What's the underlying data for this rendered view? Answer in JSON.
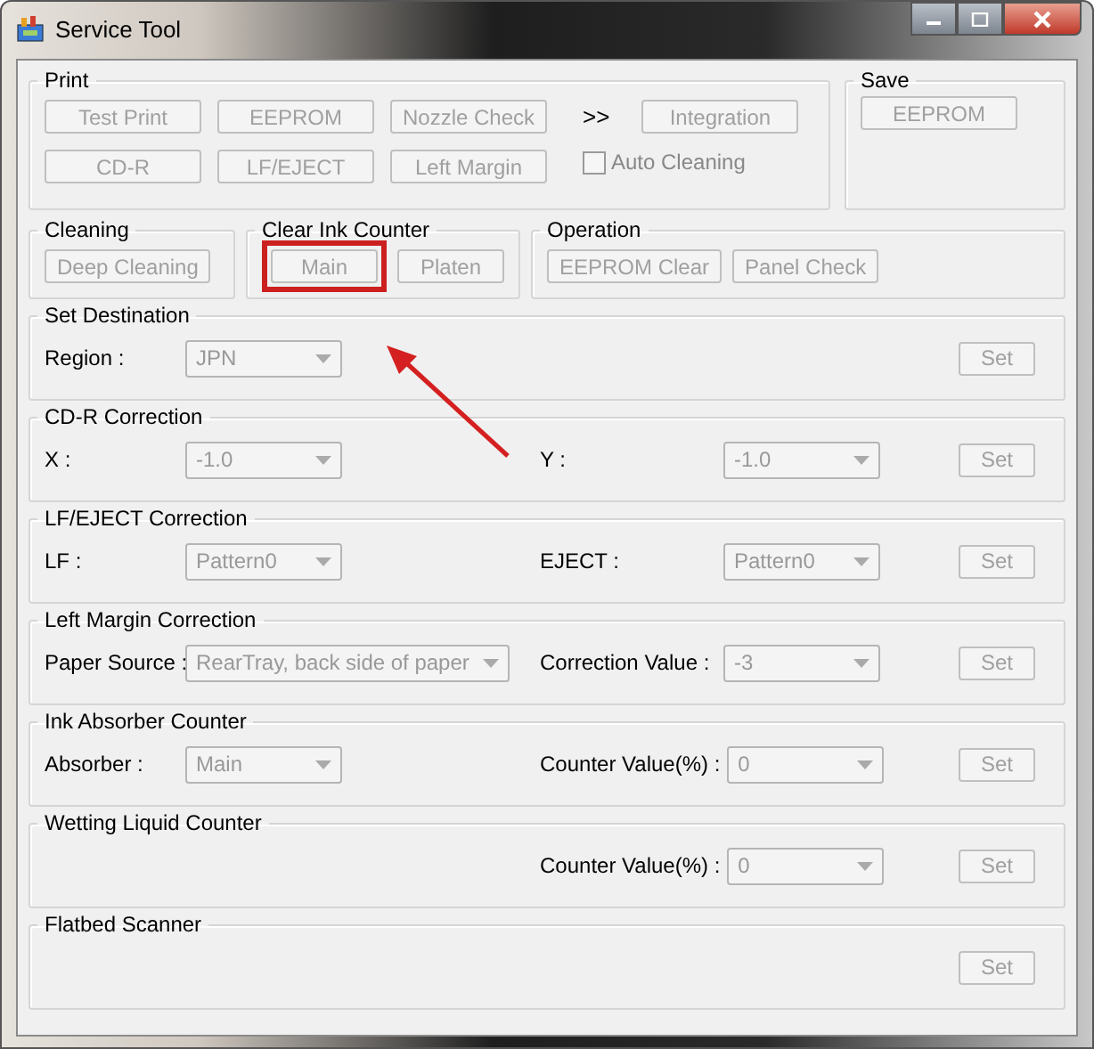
{
  "window": {
    "title": "Service Tool"
  },
  "print": {
    "title": "Print",
    "buttons": [
      {
        "label": "Test Print",
        "disabled": true
      },
      {
        "label": "EEPROM",
        "disabled": true
      },
      {
        "label": "Nozzle Check",
        "disabled": true
      },
      {
        "label": "CD-R",
        "disabled": true
      },
      {
        "label": "LF/EJECT",
        "disabled": true
      },
      {
        "label": "Left Margin",
        "disabled": true
      }
    ],
    "more": ">>",
    "integration": {
      "label": "Integration",
      "disabled": true
    },
    "auto_cleaning": {
      "label": "Auto Cleaning",
      "checked": false
    }
  },
  "save": {
    "title": "Save",
    "buttons": [
      {
        "label": "EEPROM",
        "disabled": true
      }
    ]
  },
  "cleaning": {
    "title": "Cleaning",
    "buttons": [
      {
        "label": "Deep Cleaning",
        "disabled": true
      }
    ]
  },
  "clear_ink_counter": {
    "title": "Clear Ink Counter",
    "buttons": [
      {
        "label": "Main",
        "disabled": true,
        "highlighted": true
      },
      {
        "label": "Platen",
        "disabled": true,
        "highlighted": false
      }
    ]
  },
  "operation": {
    "title": "Operation",
    "buttons": [
      {
        "label": "EEPROM Clear",
        "disabled": true
      },
      {
        "label": "Panel Check",
        "disabled": true
      }
    ]
  },
  "sections": [
    {
      "title": "Set Destination",
      "left": {
        "label": "Region :",
        "value": "JPN"
      },
      "button": {
        "label": "Set",
        "disabled": true
      }
    },
    {
      "title": "CD-R Correction",
      "left": {
        "label": "X :",
        "value": "-1.0"
      },
      "right": {
        "label": "Y :",
        "value": "-1.0"
      },
      "button": {
        "label": "Set",
        "disabled": true
      }
    },
    {
      "title": "LF/EJECT Correction",
      "left": {
        "label": "LF :",
        "value": "Pattern0"
      },
      "right": {
        "label": "EJECT :",
        "value": "Pattern0"
      },
      "button": {
        "label": "Set",
        "disabled": true
      }
    },
    {
      "title": "Left Margin Correction",
      "left": {
        "label": "Paper Source :",
        "value": "RearTray, back side of paper"
      },
      "right": {
        "label": "Correction Value :",
        "value": "-3"
      },
      "button": {
        "label": "Set",
        "disabled": true
      }
    },
    {
      "title": "Ink Absorber Counter",
      "left": {
        "label": "Absorber :",
        "value": "Main"
      },
      "right": {
        "label": "Counter Value(%) :",
        "value": "0"
      },
      "button": {
        "label": "Set",
        "disabled": true
      }
    },
    {
      "title": "Wetting Liquid Counter",
      "right": {
        "label": "Counter Value(%) :",
        "value": "0"
      },
      "button": {
        "label": "Set",
        "disabled": true
      }
    },
    {
      "title": "Flatbed Scanner",
      "button": {
        "label": "Set",
        "disabled": true
      }
    }
  ]
}
